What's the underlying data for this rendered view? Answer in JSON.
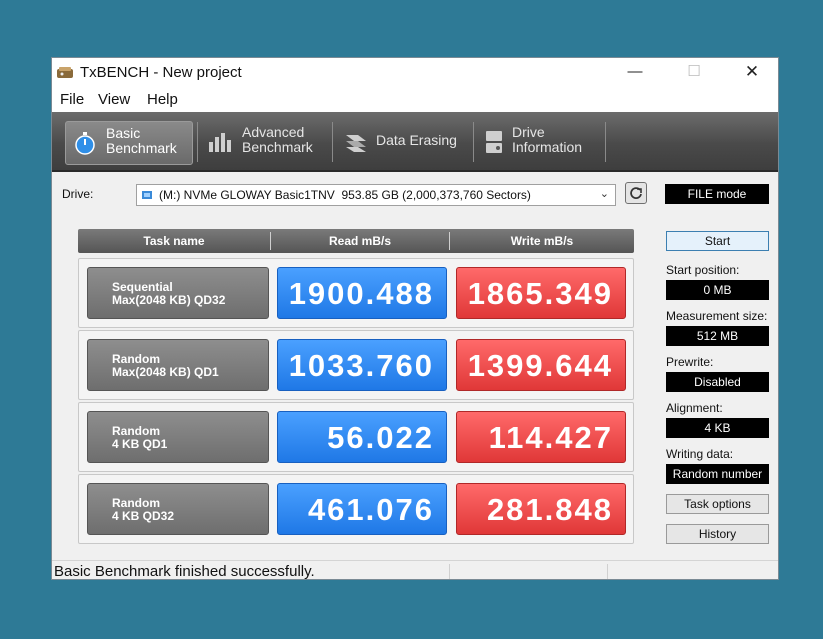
{
  "window": {
    "title": "TxBENCH - New project",
    "minimize": "—",
    "maximize": "☐",
    "close": "✕"
  },
  "menu": {
    "file": "File",
    "view": "View",
    "help": "Help"
  },
  "toolbar": {
    "basic": [
      "Basic",
      "Benchmark"
    ],
    "advanced": [
      "Advanced",
      "Benchmark"
    ],
    "erasing": "Data Erasing",
    "info": [
      "Drive",
      "Information"
    ]
  },
  "drive": {
    "label": "Drive:",
    "selected": "(M:) NVMe GLOWAY Basic1TNV  953.85 GB (2,000,373,760 Sectors)",
    "mode": "FILE mode"
  },
  "table": {
    "headers": {
      "task": "Task name",
      "read": "Read mB/s",
      "write": "Write mB/s"
    },
    "rows": [
      {
        "task1": "Sequential",
        "task2": "Max(2048 KB) QD32",
        "read": "1900.488",
        "write": "1865.349"
      },
      {
        "task1": "Random",
        "task2": "Max(2048 KB) QD1",
        "read": "1033.760",
        "write": "1399.644"
      },
      {
        "task1": "Random",
        "task2": "4 KB QD1",
        "read": "56.022",
        "write": "114.427"
      },
      {
        "task1": "Random",
        "task2": "4 KB QD32",
        "read": "461.076",
        "write": "281.848"
      }
    ]
  },
  "side": {
    "start": "Start",
    "start_position_label": "Start position:",
    "start_position": "0 MB",
    "measurement_size_label": "Measurement size:",
    "measurement_size": "512 MB",
    "prewrite_label": "Prewrite:",
    "prewrite": "Disabled",
    "alignment_label": "Alignment:",
    "alignment": "4 KB",
    "writing_data_label": "Writing data:",
    "writing_data": "Random number",
    "task_options": "Task options",
    "history": "History"
  },
  "status": {
    "message": "Basic Benchmark finished successfully."
  },
  "colors": {
    "desktop": "#2e7a96",
    "read": "#1f78e6",
    "write": "#e03838",
    "toolbar": "#4a4a4a"
  }
}
